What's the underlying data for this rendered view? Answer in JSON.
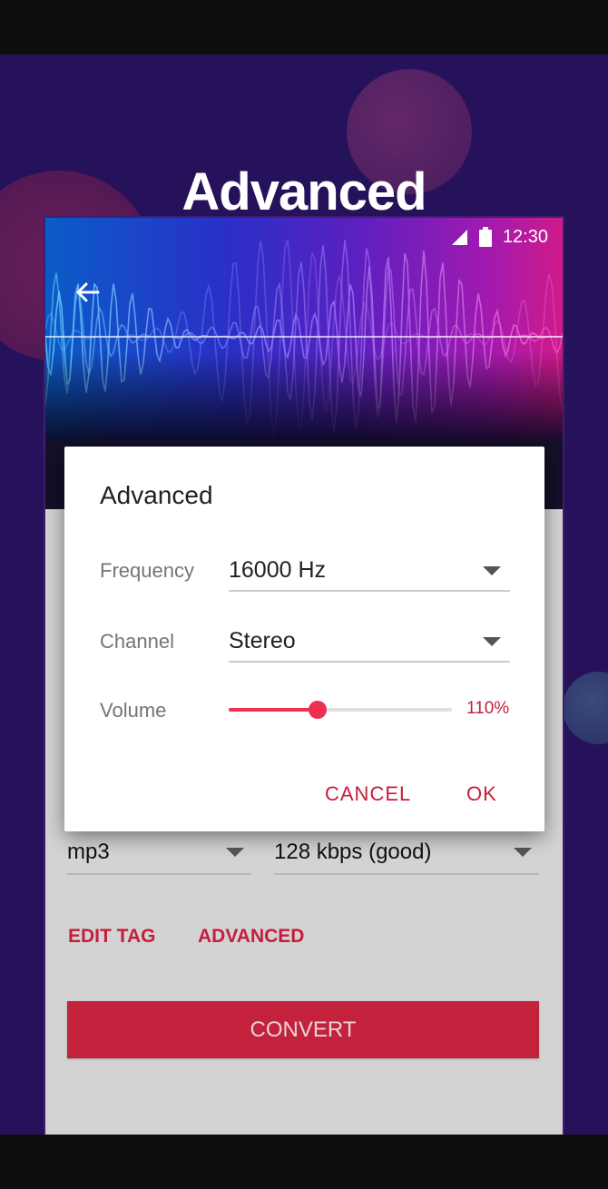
{
  "promo": {
    "title": "Advanced"
  },
  "status_bar": {
    "time": "12:30",
    "icons": [
      "signal-icon",
      "battery-icon"
    ]
  },
  "screen": {
    "format_select": {
      "value": "mp3"
    },
    "bitrate_select": {
      "value": "128 kbps (good)"
    },
    "edit_tag_label": "EDIT TAG",
    "advanced_label": "ADVANCED",
    "convert_label": "CONVERT"
  },
  "dialog": {
    "title": "Advanced",
    "frequency": {
      "label": "Frequency",
      "value": "16000 Hz"
    },
    "channel": {
      "label": "Channel",
      "value": "Stereo"
    },
    "volume": {
      "label": "Volume",
      "value_text": "110%",
      "slider_fraction": 0.4
    },
    "cancel_label": "CANCEL",
    "ok_label": "OK"
  },
  "colors": {
    "accent": "#c41e3a",
    "slider": "#ef2f4f",
    "background": "#26125a",
    "convert_button": "#c4223c"
  }
}
